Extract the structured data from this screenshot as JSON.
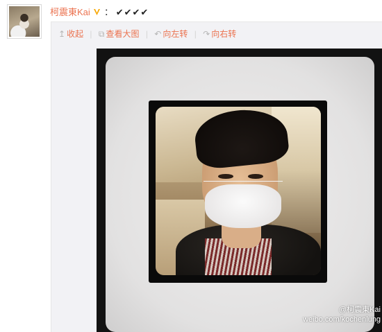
{
  "post": {
    "author": "柯震東Kai",
    "colon": "：",
    "text": "✔✔✔✔",
    "verified_badge_color": "#f7a700"
  },
  "toolbar": {
    "collapse_label": "收起",
    "large_image_label": "查看大图",
    "rotate_left_label": "向左转",
    "rotate_right_label": "向右转",
    "collapse_icon": "↥",
    "large_image_icon": "⧉",
    "rotate_left_icon": "↶",
    "rotate_right_icon": "↷",
    "separator": "|"
  },
  "watermark": {
    "handle": "@柯震東Kai",
    "url": "weibo.com/kochenlung"
  },
  "colors": {
    "accent": "#eb7350",
    "panel_bg": "#f2f2f5",
    "frame_dark": "#121212"
  },
  "icons": {
    "avatar": "avatar-photo",
    "verified": "verified-v-icon",
    "weibo": "weibo-eye-icon"
  }
}
